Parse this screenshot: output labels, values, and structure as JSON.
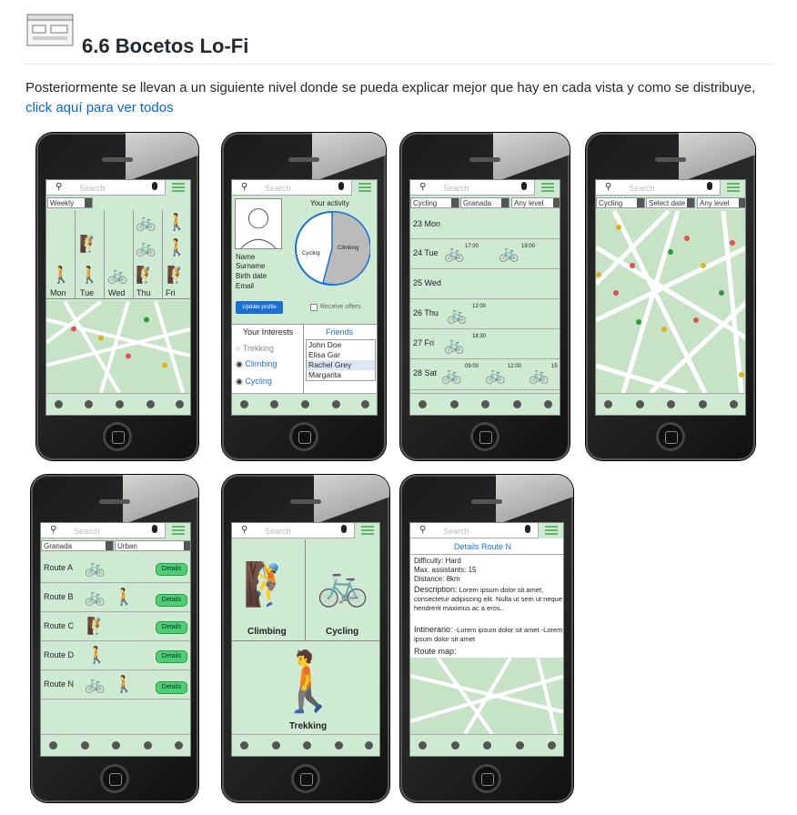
{
  "heading": {
    "title": "6.6 Bocetos Lo-Fi",
    "intro": "Posteriormente se llevan a un siguiente nivel donde se pueda explicar mejor que hay en cada vista y como se distribuye, ",
    "link": "click aquí para ver todos"
  },
  "common": {
    "search": "Search"
  },
  "colors": {
    "screen_bg": "#cfead3",
    "accent": "#6bb36d",
    "link": "#0366d6",
    "button": "#4fcf72"
  },
  "weekly": {
    "filter": "Weekly",
    "days": [
      "Mon",
      "Tue",
      "Wed",
      "Thu",
      "Fri"
    ]
  },
  "profile": {
    "activity_title": "Your activity",
    "pie": [
      "Cycling",
      "Climbing"
    ],
    "fields": [
      "Name",
      "Surname",
      "Birth date",
      "Email"
    ],
    "update": "Update profile",
    "offers": "Receive offers",
    "interests_title": "Your Interests",
    "interests": [
      "Trekking",
      "Climbing",
      "Cycling"
    ],
    "friends_title": "Friends",
    "friends": [
      "John Doe",
      "Elisa Gar",
      "Rachel Grey",
      "Margarita"
    ]
  },
  "calendar": {
    "filters": [
      "Cycling",
      "Granada",
      "Any level"
    ],
    "days": [
      {
        "label": "23 Mon",
        "times": []
      },
      {
        "label": "24 Tue",
        "times": [
          "17:00",
          "19:00"
        ]
      },
      {
        "label": "25 Wed",
        "times": []
      },
      {
        "label": "26 Thu",
        "times": [
          "12:00"
        ]
      },
      {
        "label": "27 Fri",
        "times": [
          "18:30"
        ]
      },
      {
        "label": "28 Sat",
        "times": [
          "09:00",
          "12:00",
          "15"
        ]
      }
    ]
  },
  "mapview": {
    "filters": [
      "Cycling",
      "Select date",
      "Any level"
    ]
  },
  "routes": {
    "filters": [
      "Granada",
      "Urban"
    ],
    "items": [
      "Route A",
      "Route B",
      "Route C",
      "Route D",
      "Route N"
    ],
    "details": "Details"
  },
  "categories": {
    "items": [
      "Climbing",
      "Cycling",
      "Trekking"
    ]
  },
  "detail": {
    "title": "Details Route N",
    "lines": [
      "Difficulty: Hard",
      "Max. assistants: 15",
      "Distance: 8km"
    ],
    "desc_label": "Description:",
    "desc": "Lorem ipsum dolor sit amet, consectetur adipiscing elit. Nulla ut sem ut neque hendrerit maximus ac a eros..",
    "itin_label": "Intinerario:",
    "itin": "-Lorem ipsum dolor sit amet -Lorem ipsum dolor sit amet",
    "map_label": "Route map:"
  }
}
